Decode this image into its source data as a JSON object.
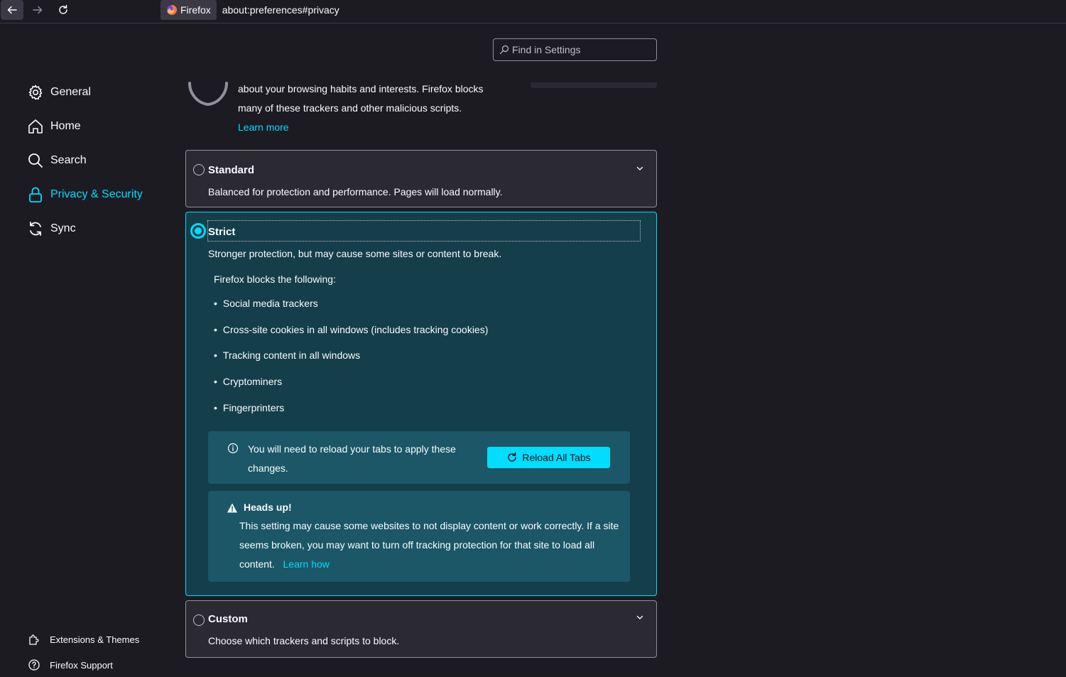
{
  "toolbar": {
    "identity_label": "Firefox",
    "url": "about:preferences#privacy"
  },
  "sidebar": {
    "items": [
      {
        "label": "General"
      },
      {
        "label": "Home"
      },
      {
        "label": "Search"
      },
      {
        "label": "Privacy & Security"
      },
      {
        "label": "Sync"
      }
    ],
    "footer": [
      {
        "label": "Extensions & Themes"
      },
      {
        "label": "Firefox Support"
      }
    ]
  },
  "search": {
    "placeholder": "Find in Settings"
  },
  "intro": {
    "line1": "about your browsing habits and interests. Firefox blocks",
    "line2": "many of these trackers and other malicious scripts.",
    "learn_more": "Learn more"
  },
  "standard": {
    "title": "Standard",
    "desc": "Balanced for protection and performance. Pages will load normally."
  },
  "strict": {
    "title": "Strict",
    "desc": "Stronger protection, but may cause some sites or content to break.",
    "blocks_title": "Firefox blocks the following:",
    "blocks": [
      "Social media trackers",
      "Cross-site cookies in all windows (includes tracking cookies)",
      "Tracking content in all windows",
      "Cryptominers",
      "Fingerprinters"
    ],
    "reload_text": "You will need to reload your tabs to apply these changes.",
    "reload_button": "Reload All Tabs",
    "warn_title": "Heads up!",
    "warn_text": "This setting may cause some websites to not display content or work correctly. If a site seems broken, you may want to turn off tracking protection for that site to load all content.",
    "learn_how": "Learn how"
  },
  "custom": {
    "title": "Custom",
    "desc": "Choose which trackers and scripts to block."
  },
  "colors": {
    "accent": "#00ddff",
    "background": "#1c1b22",
    "card": "#2b2a33",
    "selected_card": "#143e4a"
  }
}
